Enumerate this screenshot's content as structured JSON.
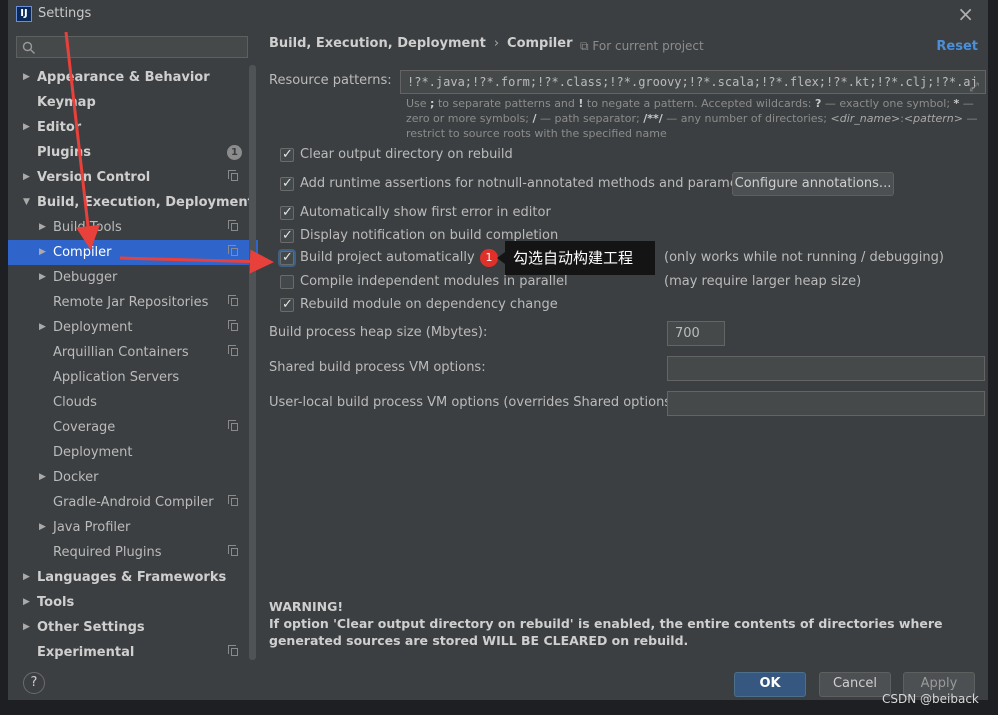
{
  "window": {
    "title": "Settings",
    "app_icon": "IJ"
  },
  "search": {
    "placeholder": ""
  },
  "sidebar": {
    "items": [
      {
        "label": "Appearance & Behavior",
        "bold": true,
        "arrow": "right",
        "indent": 0
      },
      {
        "label": "Keymap",
        "bold": true,
        "indent": 0
      },
      {
        "label": "Editor",
        "bold": true,
        "arrow": "right",
        "indent": 0
      },
      {
        "label": "Plugins",
        "bold": true,
        "indent": 0,
        "badge": "1"
      },
      {
        "label": "Version Control",
        "bold": true,
        "arrow": "right",
        "indent": 0,
        "copy": true
      },
      {
        "label": "Build, Execution, Deployment",
        "bold": true,
        "arrow": "down",
        "indent": 0
      },
      {
        "label": "Build Tools",
        "arrow": "right",
        "indent": 1,
        "copy": true
      },
      {
        "label": "Compiler",
        "arrow": "right",
        "indent": 1,
        "copy": true,
        "selected": true
      },
      {
        "label": "Debugger",
        "arrow": "right",
        "indent": 1
      },
      {
        "label": "Remote Jar Repositories",
        "indent": 1,
        "copy": true
      },
      {
        "label": "Deployment",
        "arrow": "right",
        "indent": 1,
        "copy": true
      },
      {
        "label": "Arquillian Containers",
        "indent": 1,
        "copy": true
      },
      {
        "label": "Application Servers",
        "indent": 1
      },
      {
        "label": "Clouds",
        "indent": 1
      },
      {
        "label": "Coverage",
        "indent": 1,
        "copy": true
      },
      {
        "label": "Deployment",
        "indent": 1
      },
      {
        "label": "Docker",
        "arrow": "right",
        "indent": 1
      },
      {
        "label": "Gradle-Android Compiler",
        "indent": 1,
        "copy": true
      },
      {
        "label": "Java Profiler",
        "arrow": "right",
        "indent": 1
      },
      {
        "label": "Required Plugins",
        "indent": 1,
        "copy": true
      },
      {
        "label": "Languages & Frameworks",
        "bold": true,
        "arrow": "right",
        "indent": 0
      },
      {
        "label": "Tools",
        "bold": true,
        "arrow": "right",
        "indent": 0
      },
      {
        "label": "Other Settings",
        "bold": true,
        "arrow": "right",
        "indent": 0
      },
      {
        "label": "Experimental",
        "bold": true,
        "indent": 0,
        "copy": true
      }
    ]
  },
  "header": {
    "breadcrumb_parent": "Build, Execution, Deployment",
    "breadcrumb_sep": "›",
    "breadcrumb_current": "Compiler",
    "scope": "For current project",
    "reset": "Reset"
  },
  "resource_patterns": {
    "label": "Resource patterns:",
    "value": "!?*.java;!?*.form;!?*.class;!?*.groovy;!?*.scala;!?*.flex;!?*.kt;!?*.clj;!?*.aj",
    "hint": {
      "t1": "Use ",
      "k1": ";",
      "t2": " to separate patterns and ",
      "k2": "!",
      "t3": " to negate a pattern. Accepted wildcards: ",
      "k3": "?",
      "t4": " — exactly one symbol; ",
      "k4": "*",
      "t5": " — zero or more symbols; ",
      "k5": "/",
      "t6": " — path separator; ",
      "k6": "/**/",
      "t7": " — any number of directories; ",
      "i1": "<dir_name>",
      "t8": ":",
      "i2": "<pattern>",
      "t9": " — restrict to source roots with the specified name"
    }
  },
  "options": {
    "clear_output": "Clear output directory on rebuild",
    "add_assertions": "Add runtime assertions for notnull-annotated methods and parameters",
    "configure_annotations": "Configure annotations...",
    "show_first_error": "Automatically show first error in editor",
    "display_notification": "Display notification on build completion",
    "build_automatically": "Build project automatically",
    "build_automatically_note": "(only works while not running / debugging)",
    "compile_parallel": "Compile independent modules in parallel",
    "compile_parallel_note": "(may require larger heap size)",
    "rebuild_on_dependency": "Rebuild module on dependency change"
  },
  "fields": {
    "heap_label": "Build process heap size (Mbytes):",
    "heap_value": "700",
    "shared_vm_label": "Shared build process VM options:",
    "shared_vm_value": "",
    "user_vm_label": "User-local build process VM options (overrides Shared options):",
    "user_vm_value": ""
  },
  "warning": {
    "title": "WARNING!",
    "text": "If option 'Clear output directory on rebuild' is enabled, the entire contents of directories where generated sources are stored WILL BE CLEARED on rebuild."
  },
  "annotation": {
    "number": "1",
    "text": "勾选自动构建工程",
    "arrow_color": "#e8413b"
  },
  "buttons": {
    "help": "?",
    "ok": "OK",
    "cancel": "Cancel",
    "apply": "Apply"
  },
  "watermark": "CSDN @beiback"
}
